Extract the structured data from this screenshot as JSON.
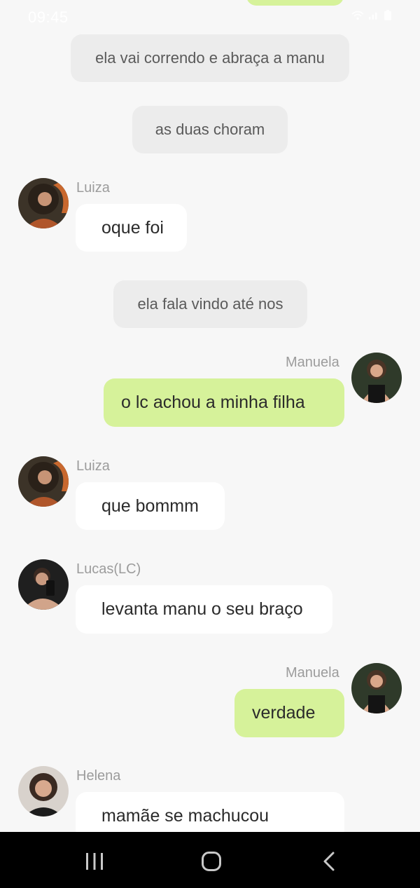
{
  "status_bar": {
    "time": "09:45",
    "icons": [
      "wifi-icon",
      "signal-icon",
      "battery-icon"
    ]
  },
  "colors": {
    "background": "#f7f7f7",
    "narration_bg": "#ececec",
    "incoming_bg": "#ffffff",
    "outgoing_bg": "#d6f29a",
    "name_text": "#9c9c9c",
    "nav_bar": "#000000"
  },
  "narrations": [
    "ela vai correndo e abraça a manu",
    "as duas choram",
    "ela fala vindo até nos"
  ],
  "messages": [
    {
      "sender": "Luiza",
      "text": "oque foi"
    },
    {
      "sender": "Manuela",
      "text": "o lc achou a minha filha"
    },
    {
      "sender": "Luiza",
      "text": "que bommm"
    },
    {
      "sender": "Lucas(LC)",
      "text": "levanta manu o seu braço"
    },
    {
      "sender": "Manuela",
      "text": "verdade"
    },
    {
      "sender": "Helena",
      "text": "mamãe se machucou"
    }
  ],
  "nav_bar": {
    "buttons": [
      "recent-apps-icon",
      "home-icon",
      "back-icon"
    ]
  }
}
